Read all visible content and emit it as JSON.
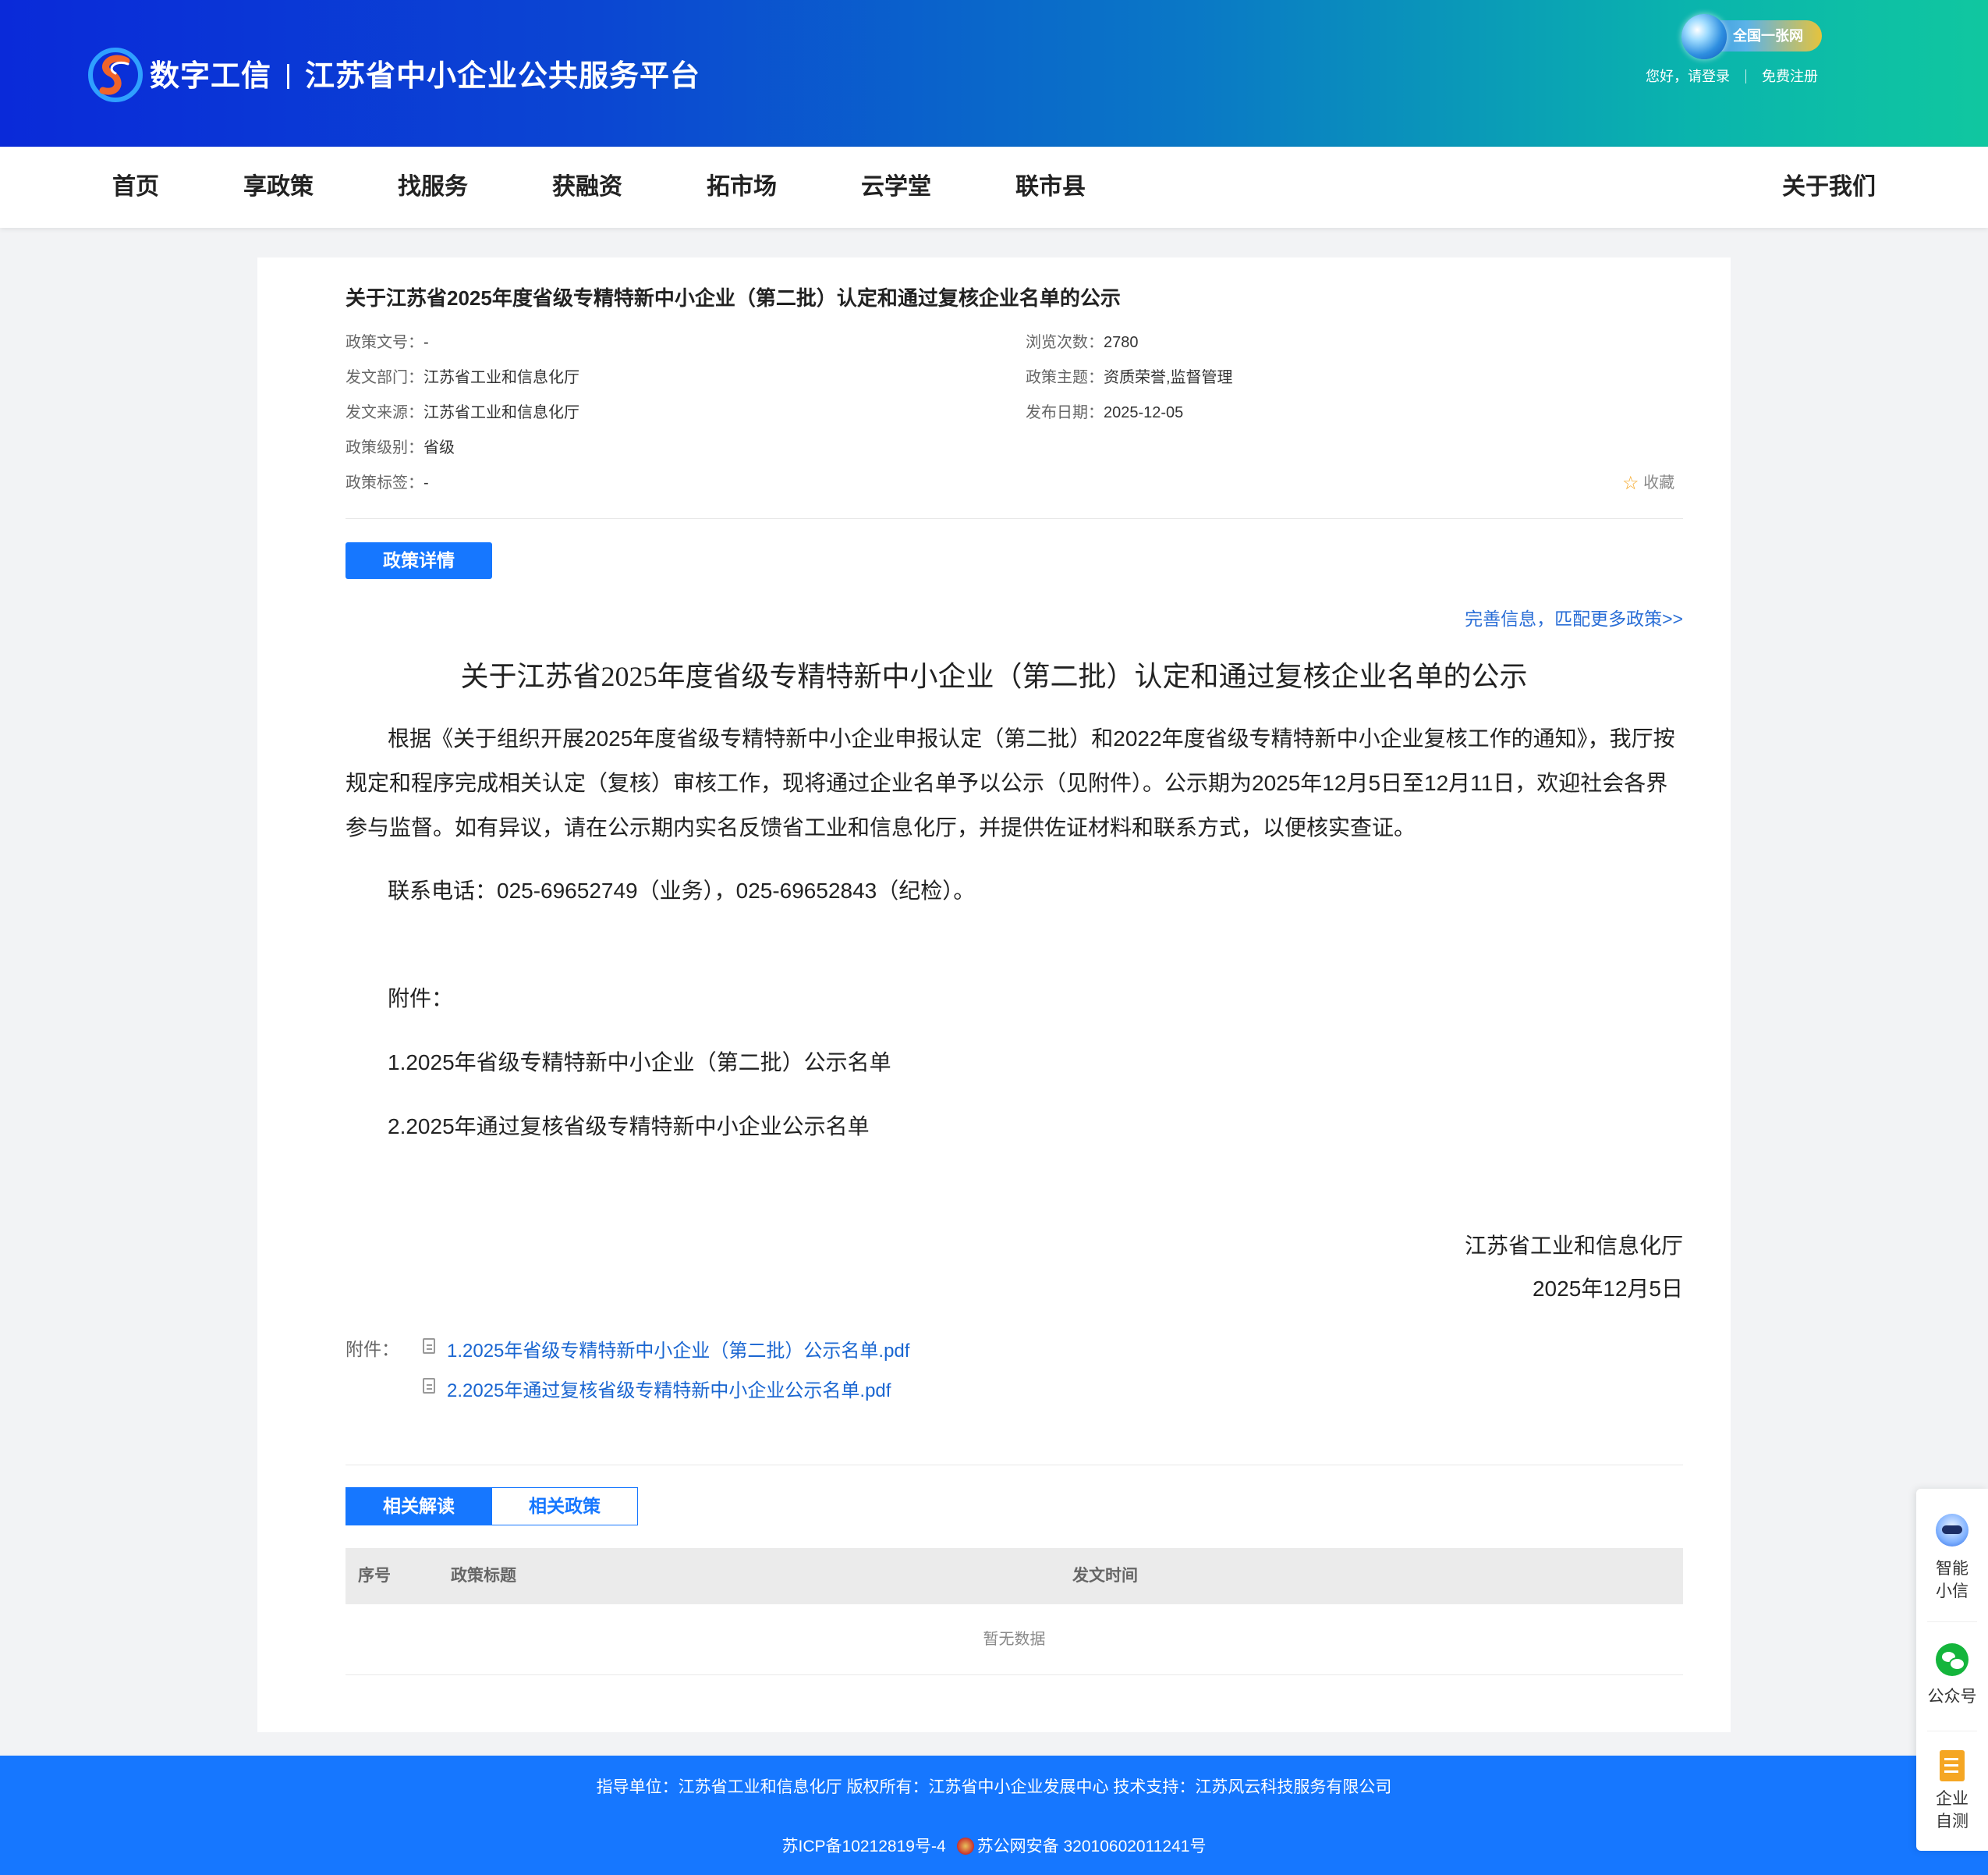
{
  "header": {
    "brand_name": "数字工信",
    "platform_name": "江苏省中小企业公共服务平台",
    "national_badge": "全国一张网",
    "greeting": "您好，请登录",
    "register": "免费注册"
  },
  "nav": {
    "items": [
      "首页",
      "享政策",
      "找服务",
      "获融资",
      "拓市场",
      "云学堂",
      "联市县"
    ],
    "about": "关于我们"
  },
  "policy": {
    "title": "关于江苏省2025年度省级专精特新中小企业（第二批）认定和通过复核企业名单的公示",
    "meta_left": [
      {
        "label": "政策文号：",
        "value": "-"
      },
      {
        "label": "发文部门：",
        "value": "江苏省工业和信息化厅"
      },
      {
        "label": "发文来源：",
        "value": "江苏省工业和信息化厅"
      },
      {
        "label": "政策级别：",
        "value": "省级"
      },
      {
        "label": "政策标签：",
        "value": "-"
      }
    ],
    "meta_right": [
      {
        "label": "浏览次数：",
        "value": "2780"
      },
      {
        "label": "政策主题：",
        "value": "资质荣誉,监督管理"
      },
      {
        "label": "发布日期：",
        "value": "2025-12-05"
      }
    ],
    "favorite": "收藏",
    "detail_button": "政策详情",
    "more_link": "完善信息，匹配更多政策>>"
  },
  "document": {
    "title": "关于江苏省2025年度省级专精特新中小企业（第二批）认定和通过复核企业名单的公示",
    "paragraph": "根据《关于组织开展2025年度省级专精特新中小企业申报认定（第二批）和2022年度省级专精特新中小企业复核工作的通知》，我厅按规定和程序完成相关认定（复核）审核工作，现将通过企业名单予以公示（见附件）。公示期为2025年12月5日至12月11日，欢迎社会各界参与监督。如有异议，请在公示期内实名反馈省工业和信息化厅，并提供佐证材料和联系方式，以便核实查证。",
    "contact": "联系电话：025-69652749（业务），025-69652843（纪检）。",
    "attachment_heading": "附件：",
    "attachment_lines": [
      "1.2025年省级专精特新中小企业（第二批）公示名单",
      "2.2025年通过复核省级专精特新中小企业公示名单"
    ],
    "signature": "江苏省工业和信息化厅",
    "date": "2025年12月5日"
  },
  "attachments": {
    "label": "附件：",
    "files": [
      "1.2025年省级专精特新中小企业（第二批）公示名单.pdf",
      "2.2025年通过复核省级专精特新中小企业公示名单.pdf"
    ]
  },
  "related": {
    "tabs": [
      "相关解读",
      "相关政策"
    ],
    "columns": [
      "序号",
      "政策标题",
      "发文时间"
    ],
    "empty_text": "暂无数据"
  },
  "footer": {
    "line1": "指导单位：江苏省工业和信息化厅   版权所有：江苏省中小企业发展中心   技术支持：江苏风云科技服务有限公司",
    "icp": "苏ICP备10212819号-4",
    "police": "苏公网安备 32010602011241号"
  },
  "sidebar": {
    "assistant": [
      "智能",
      "小信"
    ],
    "wechat": "公众号",
    "selftest": [
      "企业",
      "自测"
    ]
  },
  "colors": {
    "primary": "#1677ff",
    "link": "#1a66d1",
    "header_start": "#0a2ad9",
    "header_end": "#10c7a0"
  }
}
